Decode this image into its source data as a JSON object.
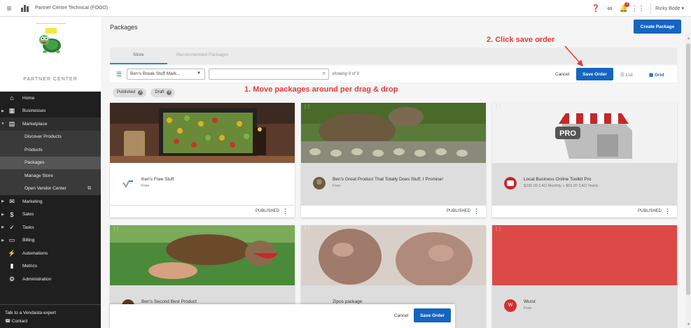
{
  "topbar": {
    "org_name": "Partner Centre Technical (FOOO)",
    "user": "Ricky Bode ▾",
    "notif_count": "3"
  },
  "sidebar": {
    "partner_center": "PARTNER CENTER",
    "items": [
      {
        "label": "Home",
        "icon": "home-icon"
      },
      {
        "label": "Businesses",
        "icon": "businesses-icon"
      },
      {
        "label": "Marketplace",
        "icon": "marketplace-icon"
      },
      {
        "label": "Discover Products"
      },
      {
        "label": "Products"
      },
      {
        "label": "Packages"
      },
      {
        "label": "Manage Store"
      },
      {
        "label": "Open Vendor Center"
      },
      {
        "label": "Marketing",
        "icon": "mail-icon"
      },
      {
        "label": "Sales",
        "icon": "dollar-icon"
      },
      {
        "label": "Tasks",
        "icon": "check-icon"
      },
      {
        "label": "Billing",
        "icon": "billing-icon"
      },
      {
        "label": "Automations",
        "icon": "automations-icon"
      },
      {
        "label": "Metrics",
        "icon": "metrics-icon"
      },
      {
        "label": "Administration",
        "icon": "gear-icon"
      }
    ],
    "footer_line1": "Talk to a Vendasta expert",
    "footer_line2": "Contact"
  },
  "main": {
    "title": "Packages",
    "create_button": "Create Package",
    "tabs": [
      "Store",
      "Recommended Packages"
    ],
    "store_select": "Ben's Break Stuff Mark...",
    "search_placeholder": "",
    "showing": "showing 9 of 9",
    "cancel": "Cancel",
    "save_order": "Save Order",
    "view_list": "List",
    "view_grid": "Grid",
    "chips": [
      "Published",
      "Draft"
    ],
    "annotation1": "1. Move packages around per drag & drop",
    "annotation2": "2. Click save order"
  },
  "cards": [
    {
      "title": "Ken's Free Stuff",
      "sub": "Free",
      "status": "PUBLISHED"
    },
    {
      "title": "Ben's Great Product That Totally Does Stuff, I Promise!",
      "sub": "Free",
      "status": "PUBLISHED"
    },
    {
      "title": "Local Business Online Toolkit Pro",
      "sub": "$230.00 CAD Monthly + $55.00 CAD Yearly",
      "status": "PUBLISHED"
    },
    {
      "title": "Ben's Second Best Product",
      "sub": "",
      "status": ""
    },
    {
      "title": "Zipos package",
      "sub": "",
      "status": ""
    },
    {
      "title": "Wurst",
      "sub": "Free",
      "status": "",
      "avatar_letter": "W"
    }
  ],
  "bottom_bar": {
    "cancel": "Cancel",
    "save": "Save Order"
  },
  "colors": {
    "primary": "#1565c0",
    "annotation": "#e53935",
    "sidebar": "#1f1f1f"
  }
}
